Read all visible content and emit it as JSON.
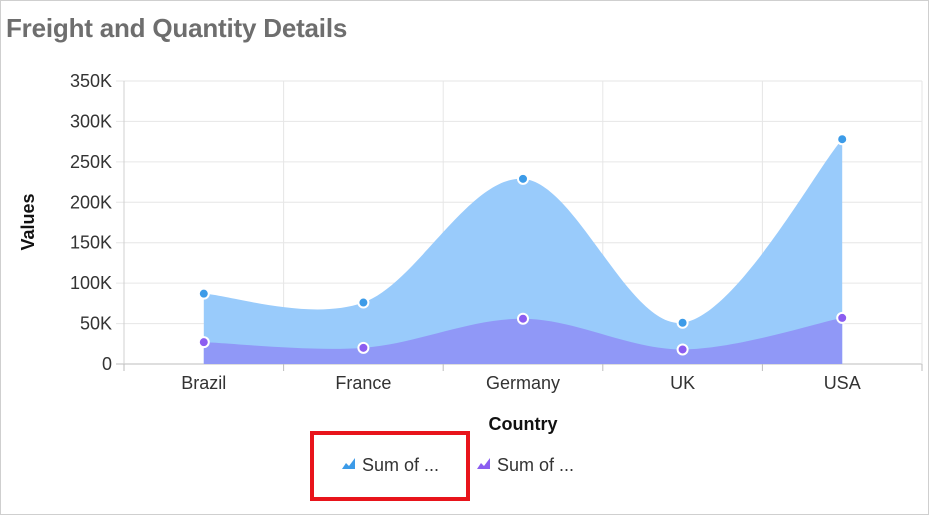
{
  "title": "Freight and Quantity Details",
  "colors": {
    "series1_fill": "#99cbfb",
    "series1_marker": "#3c9be8",
    "series2_fill": "#8f95f7",
    "series2_marker": "#8b5df0",
    "highlight_box": "#e8141b"
  },
  "chart_data": {
    "type": "area",
    "smooth": true,
    "title": "Freight and Quantity Details",
    "xlabel": "Country",
    "ylabel": "Values",
    "categories": [
      "Brazil",
      "France",
      "Germany",
      "UK",
      "USA"
    ],
    "ylim": [
      0,
      350000
    ],
    "yticks": [
      0,
      50000,
      100000,
      150000,
      200000,
      250000,
      300000,
      350000
    ],
    "ytick_labels": [
      "0",
      "50K",
      "100K",
      "150K",
      "200K",
      "250K",
      "300K",
      "350K"
    ],
    "grid": true,
    "legend_position": "bottom",
    "series": [
      {
        "name": "Sum of ...",
        "values": [
          87000,
          76000,
          229000,
          51000,
          278000
        ]
      },
      {
        "name": "Sum of ...",
        "values": [
          27000,
          20000,
          56000,
          18000,
          57000
        ]
      }
    ]
  },
  "legend": {
    "items": [
      {
        "label": "Sum of ...",
        "icon": "area-series-icon",
        "highlighted": true
      },
      {
        "label": "Sum of ...",
        "icon": "area-series-icon",
        "highlighted": false
      }
    ]
  }
}
